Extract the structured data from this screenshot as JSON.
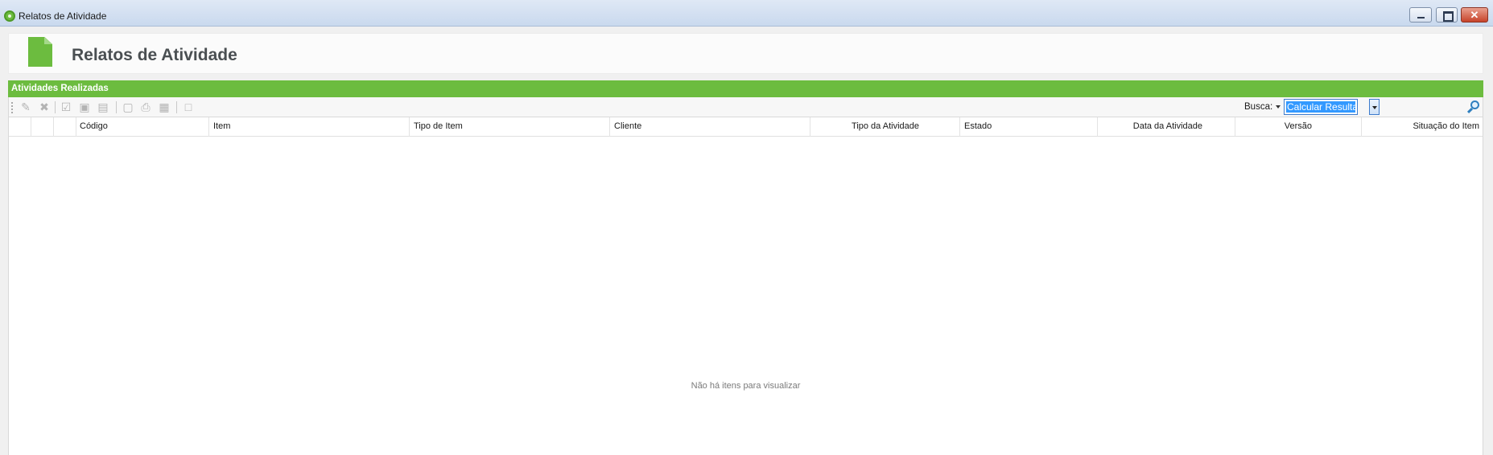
{
  "window": {
    "title": "Relatos de Atividade"
  },
  "page": {
    "title": "Relatos de Atividade"
  },
  "section": {
    "title": "Atividades Realizadas"
  },
  "toolbar": {
    "search_label": "Busca:",
    "search_value": "Calcular Resulta"
  },
  "grid": {
    "columns": [
      "Código",
      "Item",
      "Tipo de Item",
      "Cliente",
      "Tipo da Atividade",
      "Estado",
      "Data da Atividade",
      "Versão",
      "Situação do Item"
    ],
    "empty_message": "Não há itens para visualizar"
  },
  "colors": {
    "accent": "#6cbc3f",
    "selection": "#3399ff"
  }
}
